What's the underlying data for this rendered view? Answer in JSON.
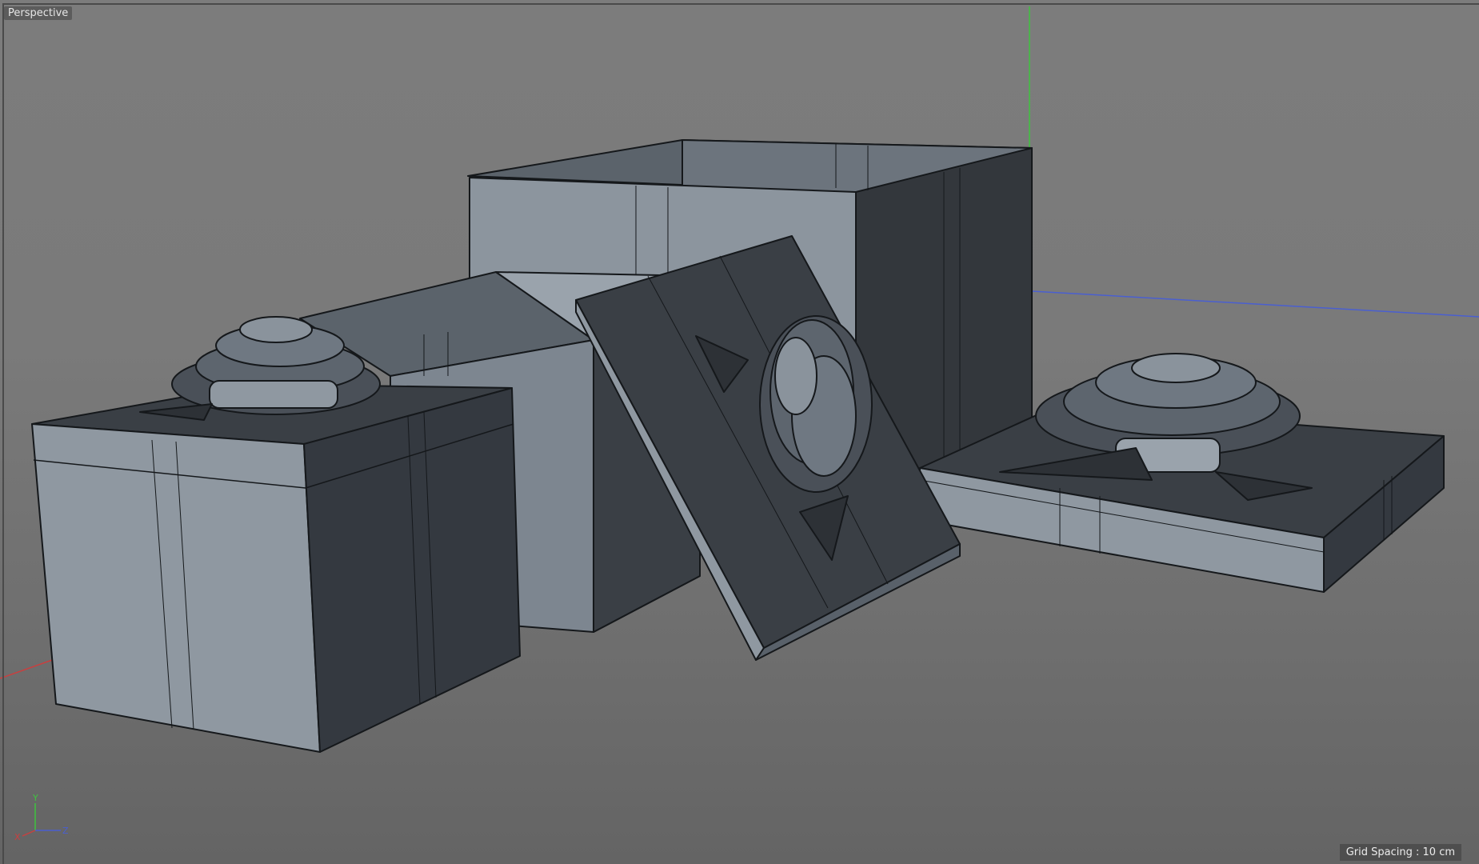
{
  "viewport": {
    "view_name": "Perspective",
    "grid_spacing": "Grid Spacing : 10 cm"
  },
  "axis_gizmo": {
    "x_label": "X",
    "y_label": "Y",
    "z_label": "Z",
    "colors": {
      "x": "#c84040",
      "y": "#3fc43f",
      "z": "#4a5fd0"
    }
  },
  "scene": {
    "objects": [
      "small-gift-box",
      "open-tall-gift-box",
      "tilted-lid-with-bow",
      "flat-lid-with-bow"
    ],
    "colors": {
      "face_dark": "#33373c",
      "face_mid": "#4a5058",
      "face_light": "#7d8690",
      "wire": "#15181b"
    }
  }
}
